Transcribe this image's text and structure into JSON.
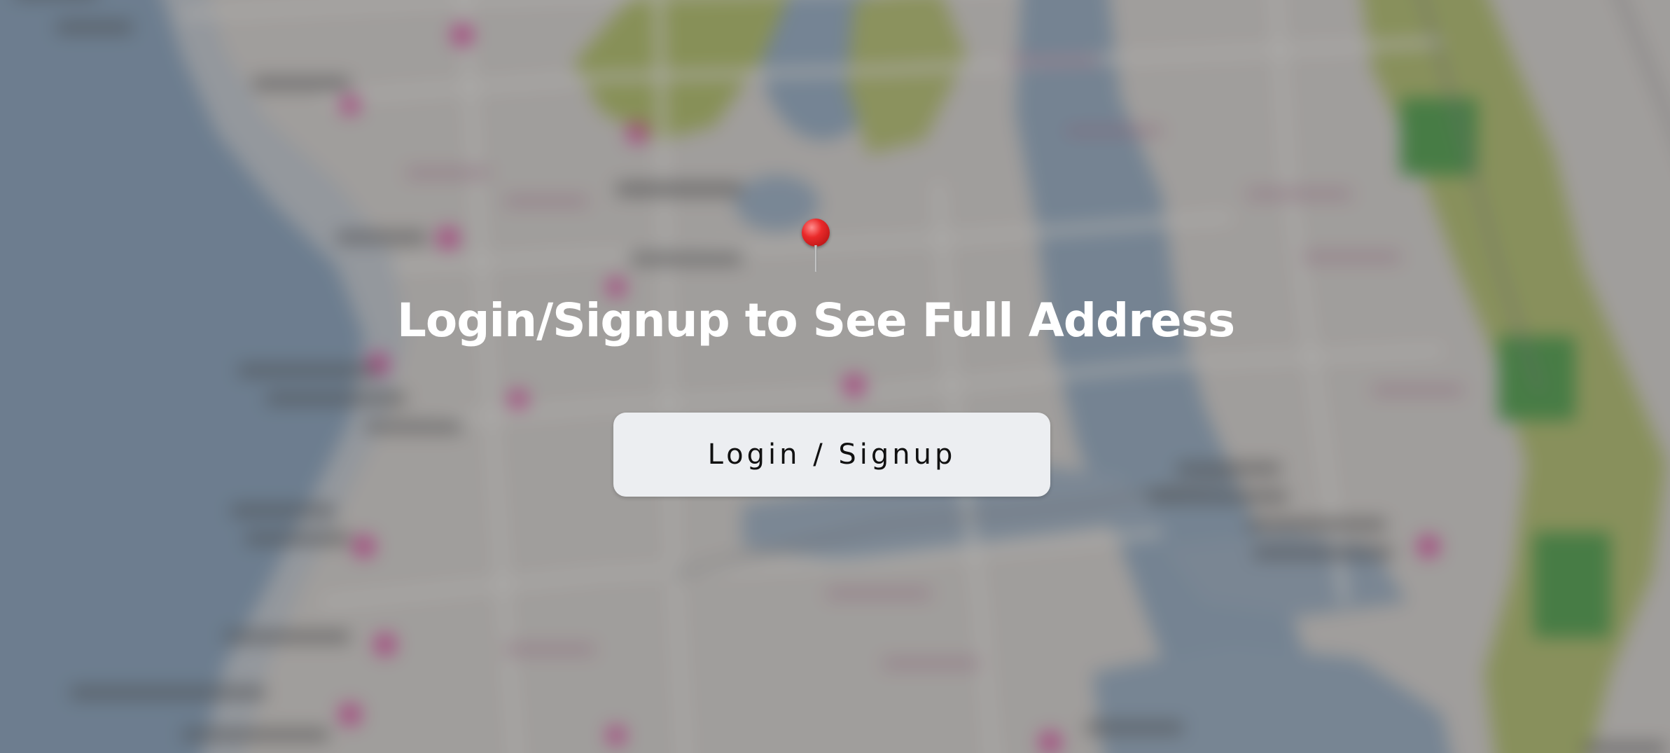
{
  "overlay": {
    "headline": "Login/Signup to See Full Address",
    "button_label": "Login / Signup",
    "pin_icon": "pushpin-icon"
  },
  "map": {
    "description_colors": {
      "sea": "#8fa7bd",
      "land": "#dedbd6",
      "park": "#b9c774",
      "forest": "#4fa34c",
      "marker": "#e85aa6"
    }
  },
  "colors": {
    "headline": "#ffffff",
    "button_bg": "#eceef1",
    "button_text": "#111111",
    "pin": "#e52b2b"
  }
}
